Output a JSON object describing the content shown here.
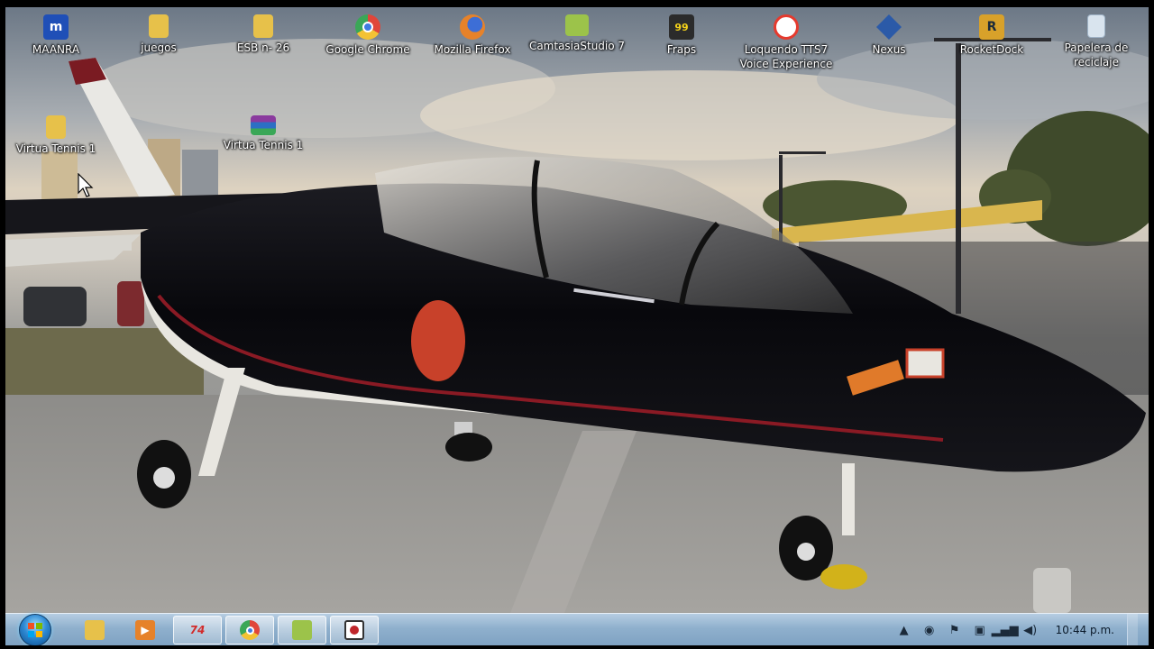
{
  "desktop_icons": [
    {
      "label": "MAANRA",
      "glyph": "m",
      "color": "#1f4fb7"
    },
    {
      "label": "juegos",
      "glyph": "",
      "color": "#e7c14a"
    },
    {
      "label": "ESB n- 26",
      "glyph": "",
      "color": "#e7c14a"
    },
    {
      "label": "Google Chrome",
      "glyph": "",
      "color": "#e0463a"
    },
    {
      "label": "Mozilla Firefox",
      "glyph": "",
      "color": "#e6822a"
    },
    {
      "label": "CamtasiaStudio 7",
      "glyph": "",
      "color": "#9cc34a"
    },
    {
      "label": "Fraps",
      "glyph": "99",
      "color": "#2b2b2b"
    },
    {
      "label": "Loquendo TTS7 Voice Experience",
      "glyph": "",
      "color": "#e53a2e"
    },
    {
      "label": "Nexus",
      "glyph": "",
      "color": "#2b5aa8"
    },
    {
      "label": "RocketDock",
      "glyph": "R",
      "color": "#d8a12a"
    },
    {
      "label": "Papelera de reciclaje",
      "glyph": "",
      "color": "#d9e4ee"
    },
    {
      "label": "Virtua Tennis 1",
      "glyph": "",
      "color": "#e7c14a"
    },
    {
      "label": "Virtua Tennis 1",
      "glyph": "",
      "color": "#8a3a9e"
    }
  ],
  "taskbar": {
    "start_label": "Start",
    "buttons": [
      {
        "name": "explorer",
        "glyph": "",
        "color": "#e7c14a",
        "open": false
      },
      {
        "name": "media-player",
        "glyph": "▶",
        "color": "#e6822a",
        "open": false
      },
      {
        "name": "app-74",
        "glyph": "74",
        "color": "#d22b2b",
        "open": true
      },
      {
        "name": "chrome",
        "glyph": "",
        "color": "#e0463a",
        "open": true
      },
      {
        "name": "camtasia",
        "glyph": "",
        "color": "#9cc34a",
        "open": true
      },
      {
        "name": "recorder",
        "glyph": "",
        "color": "#c0262b",
        "open": true
      }
    ],
    "clock": "10:44 p.m."
  },
  "colors": {
    "taskbar_top": "#b6cde2",
    "taskbar_bottom": "#7fa2c2",
    "icon_label": "#ffffff"
  }
}
